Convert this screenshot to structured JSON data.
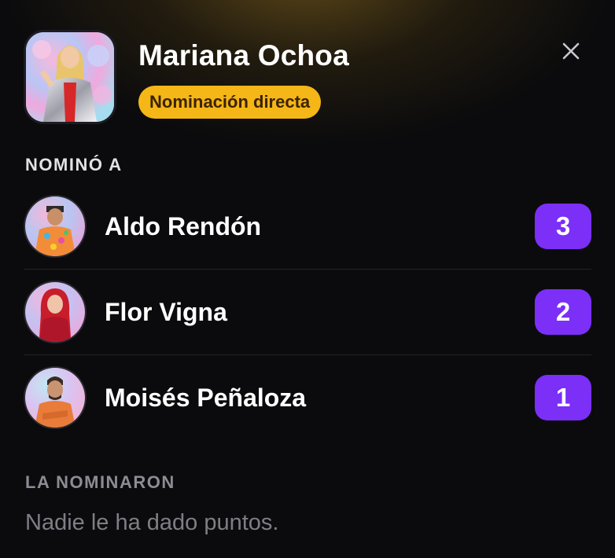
{
  "profile": {
    "name": "Mariana Ochoa",
    "badge": "Nominación directa",
    "avatar_icon": "contestant-photo"
  },
  "close_icon": "close-icon",
  "nominated": {
    "title": "NOMINÓ A",
    "items": [
      {
        "name": "Aldo Rendón",
        "points": "3"
      },
      {
        "name": "Flor Vigna",
        "points": "2"
      },
      {
        "name": "Moisés Peñaloza",
        "points": "1"
      }
    ]
  },
  "nominated_by": {
    "title": "LA NOMINARON",
    "empty_text": "Nadie le ha dado puntos."
  },
  "colors": {
    "badge_bg": "#f5b617",
    "points_bg": "#7b2ff7",
    "background": "#0b0b0d"
  }
}
